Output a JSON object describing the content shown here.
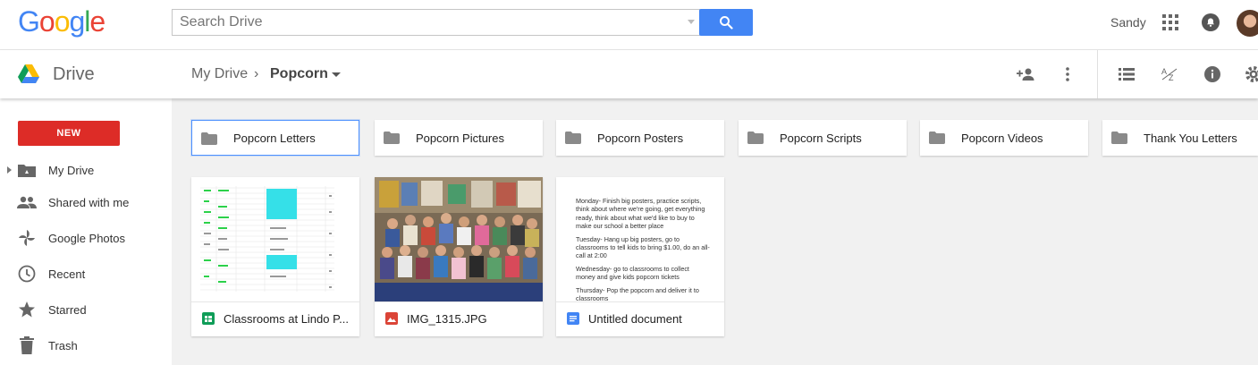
{
  "header": {
    "logo_letters": [
      {
        "ch": "G",
        "color": "#4285f4"
      },
      {
        "ch": "o",
        "color": "#ea4335"
      },
      {
        "ch": "o",
        "color": "#fbbc05"
      },
      {
        "ch": "g",
        "color": "#4285f4"
      },
      {
        "ch": "l",
        "color": "#34a853"
      },
      {
        "ch": "e",
        "color": "#ea4335"
      }
    ],
    "search_placeholder": "Search Drive",
    "user_name": "Sandy"
  },
  "subbar": {
    "app_title": "Drive",
    "breadcrumb_root": "My Drive",
    "breadcrumb_sep": "›",
    "breadcrumb_current": "Popcorn"
  },
  "sidebar": {
    "new_label": "NEW",
    "items": [
      {
        "label": "My Drive",
        "icon": "drive-folder-icon"
      },
      {
        "label": "Shared with me",
        "icon": "people-icon"
      },
      {
        "label": "Google Photos",
        "icon": "photos-pinwheel-icon"
      },
      {
        "label": "Recent",
        "icon": "clock-icon"
      },
      {
        "label": "Starred",
        "icon": "star-icon"
      },
      {
        "label": "Trash",
        "icon": "trash-icon"
      }
    ]
  },
  "folders": [
    {
      "name": "Popcorn Letters",
      "selected": true
    },
    {
      "name": "Popcorn Pictures",
      "selected": false
    },
    {
      "name": "Popcorn Posters",
      "selected": false
    },
    {
      "name": "Popcorn Scripts",
      "selected": false
    },
    {
      "name": "Popcorn Videos",
      "selected": false
    },
    {
      "name": "Thank You Letters",
      "selected": false
    }
  ],
  "files": [
    {
      "name": "Classrooms at Lindo P...",
      "type": "spreadsheet",
      "icon_color": "#0f9d58"
    },
    {
      "name": "IMG_1315.JPG",
      "type": "image",
      "icon_color": "#db4437"
    },
    {
      "name": "Untitled document",
      "type": "document",
      "icon_color": "#4285f4"
    }
  ],
  "doc_preview": [
    "Monday- Finish big posters, practice scripts, think about where we're going, get everything ready, think about what we'd like to buy to make our school a better place",
    "Tuesday- Hang up big posters, go to classrooms to tell kids to bring $1.00, do an all-call at 2:00",
    "Wednesday- go to classrooms to collect money and give kids popcorn tickets",
    "Thursday- Pop the popcorn and deliver it to classrooms"
  ]
}
